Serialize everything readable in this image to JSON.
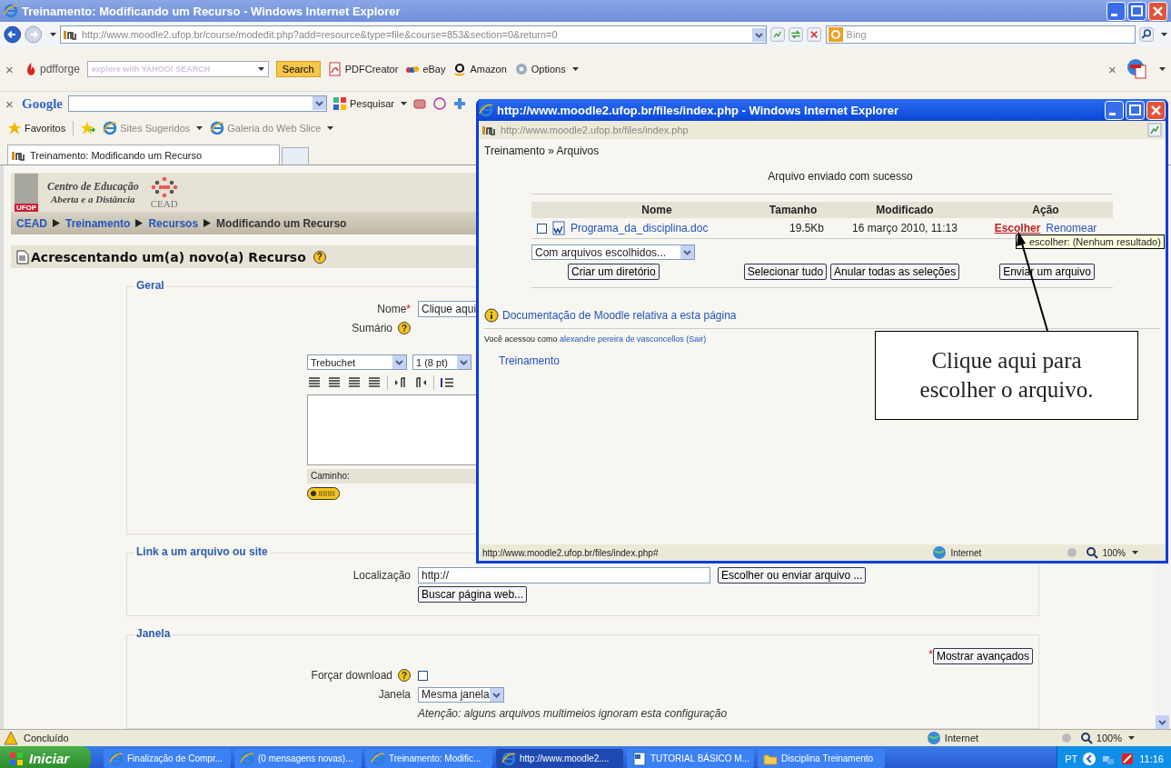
{
  "browser": {
    "title": "Treinamento: Modificando um Recurso - Windows Internet Explorer",
    "address": "http://www.moodle2.ufop.br/course/modedit.php?add=resource&type=file&course=853&section=0&return=0",
    "search_placeholder": "Bing",
    "toolbar": {
      "close": "×",
      "right_close": "×",
      "brand": "pdfforge",
      "search_placeholder": "explore with YAHOO! SEARCH",
      "search_button": "Search",
      "links": [
        "PDFCreator",
        "eBay",
        "Amazon",
        "Options"
      ]
    },
    "google": {
      "close": "×",
      "brand": "Google",
      "search_button": "Pesquisar"
    },
    "favorites": {
      "label": "Favoritos",
      "links": [
        "Sites Sugeridos",
        "Galeria do Web Slice"
      ]
    },
    "tabs": [
      {
        "label": "Treinamento: Modificando um Recurso",
        "selected": true
      }
    ],
    "status": "Concluído",
    "zone": "Internet",
    "zoom": "100%"
  },
  "page": {
    "logo": {
      "badge": "UFOP",
      "line1": "Centro de Educação",
      "line2": "Aberta e a Distância",
      "mark": "CEAD"
    },
    "breadcrumb": [
      {
        "label": "CEAD",
        "link": true
      },
      {
        "label": "Treinamento",
        "link": true
      },
      {
        "label": "Recursos",
        "link": true
      },
      {
        "label": "Modificando um Recurso",
        "link": false
      }
    ],
    "heading": "Acrescentando um(a) novo(a) Recurso",
    "heading_help": "?",
    "geral": {
      "legend": "Geral",
      "name_label": "Nome",
      "required_mark": "*",
      "name_value": "Clique aqui",
      "summary_label": "Sumário",
      "summary_help": "?",
      "font": "Trebuchet",
      "size": "1 (8 pt)",
      "path_label": "Caminho:"
    },
    "link": {
      "legend": "Link a um arquivo ou site",
      "location_label": "Localização",
      "location_value": "http://",
      "choose_button": "Escolher ou enviar arquivo ...",
      "search_button": "Buscar página web..."
    },
    "janela": {
      "legend": "Janela",
      "advanced_mark": "*",
      "advanced_button": "Mostrar avançados",
      "download_label": "Forçar download",
      "download_help": "?",
      "download_checked": false,
      "window_label": "Janela",
      "window_value": "Mesma janela",
      "note": "Atenção: alguns arquivos multimeios ignoram esta configuração"
    }
  },
  "popup": {
    "title": "http://www.moodle2.ufop.br/files/index.php - Windows Internet Explorer",
    "address": "http://www.moodle2.ufop.br/files/index.php",
    "breadcrumb": "Treinamento » Arquivos",
    "message": "Arquivo enviado com sucesso",
    "columns": [
      "Nome",
      "Tamanho",
      "Modificado",
      "Ação"
    ],
    "rows": [
      {
        "checked": false,
        "name": "Programa_da_disciplina.doc",
        "size": "19.5Kb",
        "modified": "16 março 2010, 11:13",
        "actions": [
          {
            "label": "Escolher",
            "hovered": true
          },
          {
            "label": "Renomear",
            "hovered": false
          }
        ]
      }
    ],
    "bulk_select": "Com arquivos escolhidos...",
    "buttons": [
      "Criar um diretório",
      "Selecionar tudo",
      "Anular todas as seleções",
      "Enviar um arquivo"
    ],
    "doc_link": "Documentação de Moodle relativa a esta página",
    "login": {
      "text": "Você acessou como",
      "user": "alexandre pereira de vasconcellos",
      "logout": "(Sair)"
    },
    "nav_link": "Treinamento",
    "tooltip": "escolher: (Nenhum resultado)",
    "status": "http://www.moodle2.ufop.br/files/index.php#",
    "zone": "Internet",
    "zoom": "100%"
  },
  "callout": "Clique aqui para escolher o arquivo.",
  "taskbar": {
    "start": "Iniciar",
    "items": [
      {
        "label": "Finalização de Compr...",
        "kind": "ie",
        "selected": false
      },
      {
        "label": "(0 mensagens novas)...",
        "kind": "ie",
        "selected": false
      },
      {
        "label": "Treinamento: Modific...",
        "kind": "ie",
        "selected": false
      },
      {
        "label": "http://www.moodle2....",
        "kind": "ie",
        "selected": true
      },
      {
        "label": "TUTORIAL BÁSICO M...",
        "kind": "doc",
        "selected": false
      },
      {
        "label": "Disciplina Treinamento",
        "kind": "folder",
        "selected": false
      }
    ],
    "lang": "PT",
    "clock": "11:16"
  }
}
